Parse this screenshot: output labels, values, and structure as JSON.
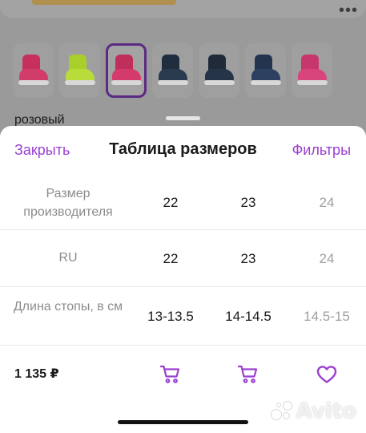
{
  "background": {
    "color_label": "розовый",
    "thumbnails": [
      {
        "upper": "#c7305e",
        "toe": "#d23c6a",
        "selected": false
      },
      {
        "upper": "#a8cf2a",
        "toe": "#b9dc3a",
        "selected": false
      },
      {
        "upper": "#c02e5c",
        "toe": "#d43a6c",
        "selected": true
      },
      {
        "upper": "#1f2d3f",
        "toe": "#2a3a4f",
        "selected": false
      },
      {
        "upper": "#202b3a",
        "toe": "#26344a",
        "selected": false
      },
      {
        "upper": "#24344f",
        "toe": "#2e4060",
        "selected": false
      },
      {
        "upper": "#c8376c",
        "toe": "#d8457a",
        "selected": false
      }
    ]
  },
  "sheet": {
    "close_label": "Закрыть",
    "title": "Таблица размеров",
    "filters_label": "Фильтры"
  },
  "table": {
    "rows": [
      {
        "label": "Размер производителя",
        "values": [
          "22",
          "23",
          "24"
        ]
      },
      {
        "label": "RU",
        "values": [
          "22",
          "23",
          "24"
        ]
      },
      {
        "label": "Длина стопы, в см",
        "values": [
          "13-13.5",
          "14-14.5",
          "14.5-15"
        ]
      }
    ]
  },
  "footer": {
    "price": "1 135 ₽",
    "actions": [
      "cart-icon",
      "cart-icon",
      "heart-icon"
    ]
  },
  "watermark": "Avito",
  "colors": {
    "accent": "#9b3fd1",
    "selected_thumb_border": "#5b2a83"
  }
}
